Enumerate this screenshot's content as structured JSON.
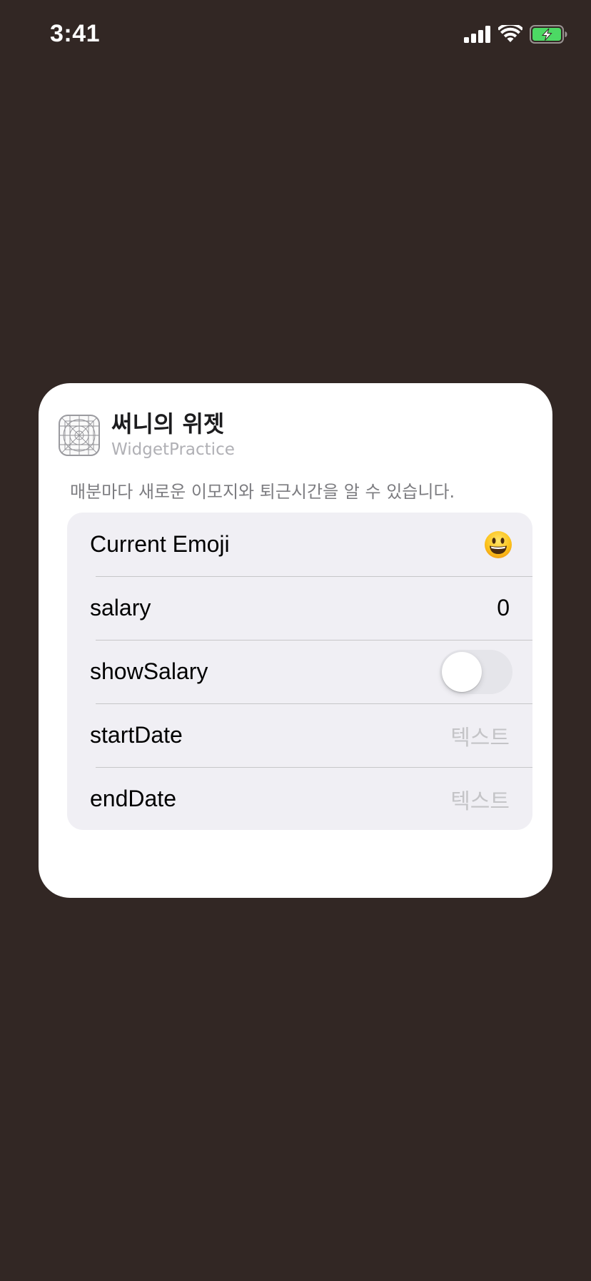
{
  "status_bar": {
    "time": "3:41",
    "icons": [
      "cellular-signal-icon",
      "wifi-icon",
      "battery-charging-icon"
    ],
    "battery_color": "#4cd964"
  },
  "widget_config": {
    "title": "써니의 위젯",
    "app_name": "WidgetPractice",
    "description": "매분마다 새로운 이모지와 퇴근시간을 알 수 있습니다.",
    "rows": [
      {
        "label": "Current Emoji",
        "type": "emoji",
        "value": "😃",
        "icon": "smiley-emoji-icon"
      },
      {
        "label": "salary",
        "type": "value",
        "value": "0"
      },
      {
        "label": "showSalary",
        "type": "toggle",
        "value": false
      },
      {
        "label": "startDate",
        "type": "placeholder",
        "placeholder": "텍스트"
      },
      {
        "label": "endDate",
        "type": "placeholder",
        "placeholder": "텍스트"
      }
    ]
  },
  "colors": {
    "background": "#322724",
    "card": "#ffffff",
    "list_background": "#f0eff4",
    "placeholder": "#c4c4c7",
    "toggle_off": "#e5e5ea"
  }
}
